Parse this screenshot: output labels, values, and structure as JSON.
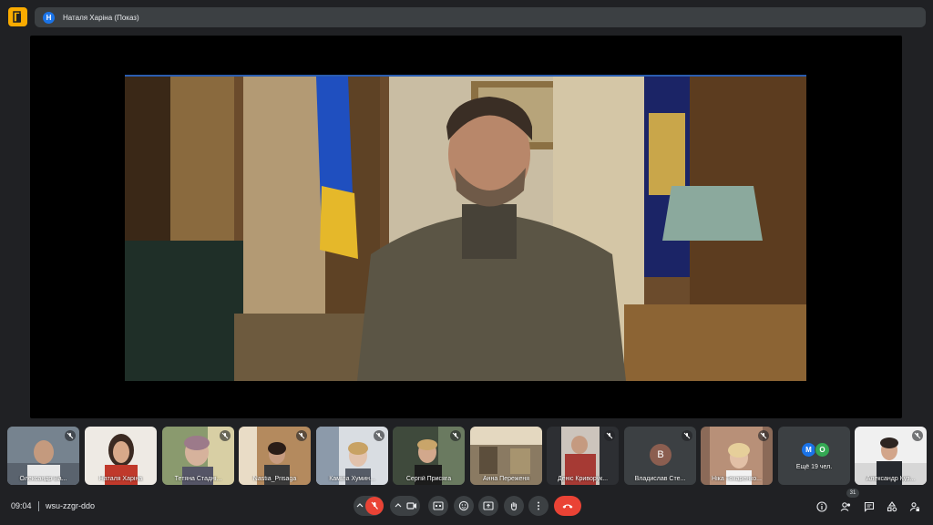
{
  "presenter": {
    "initial": "Н",
    "label": "Наталя Харіна (Показ)"
  },
  "participants": [
    {
      "name": "Олександр Ва...",
      "muted": true
    },
    {
      "name": "Наталя Харіна",
      "muted": false
    },
    {
      "name": "Тетяна Стадні...",
      "muted": true
    },
    {
      "name": "Nastia_Prisaga",
      "muted": true
    },
    {
      "name": "Каміла Хумин...",
      "muted": true
    },
    {
      "name": "Сергій Присяга",
      "muted": true
    },
    {
      "name": "Анна Переженя",
      "muted": true
    },
    {
      "name": "Деніс Криворук...",
      "muted": true
    },
    {
      "name": "Владислав Сте...",
      "muted": true,
      "initial": "В"
    },
    {
      "name": "Ніка Токаренко...",
      "muted": true
    },
    {
      "name": "Ещё 19 чел.",
      "muted": false,
      "initials": [
        "М",
        "О"
      ]
    },
    {
      "name": "Александр Куз...",
      "muted": true
    }
  ],
  "meeting": {
    "time": "09:04",
    "code": "wsu-zzgr-ddo"
  },
  "people_count": "31",
  "colors": {
    "background": "#202124",
    "end_call": "#ea4335",
    "mic_off": "#ea4335",
    "accent": "#1a73e8"
  }
}
